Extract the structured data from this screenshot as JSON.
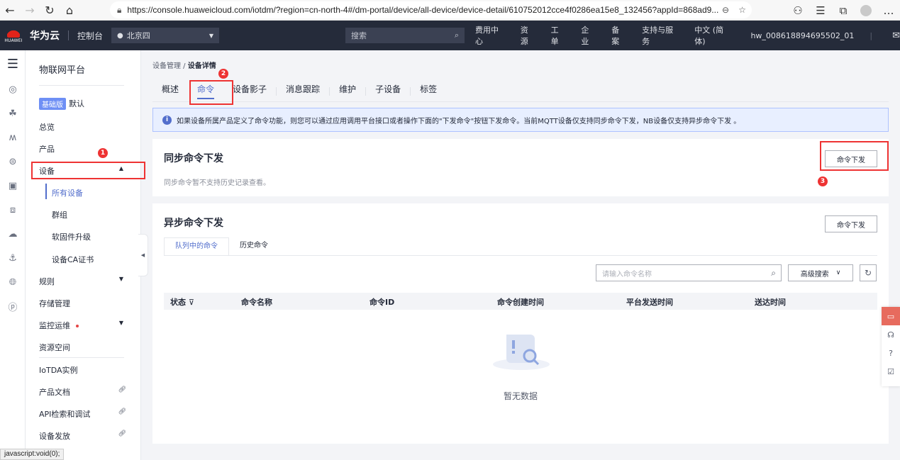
{
  "browser": {
    "url": "https://console.huaweicloud.com/iotdm/?region=cn-north-4#/dm-portal/device/all-device/device-detail/610752012cce4f0286ea15e8_132456?appId=868ad9...",
    "status_url": "javascript:void(0);"
  },
  "topnav": {
    "brand": "华为云",
    "logo_text": "HUAWEI",
    "console": "控制台",
    "region": "北京四",
    "search_placeholder": "搜索",
    "menu": [
      "费用中心",
      "资源",
      "工单",
      "企业",
      "备案",
      "支持与服务",
      "中文 (简体)"
    ],
    "user": "hw_008618894695502_01"
  },
  "sidebar": {
    "title": "物联网平台",
    "edition_badge": "基础版",
    "edition_name": "默认",
    "overview": "总览",
    "product": "产品",
    "device": "设备",
    "device_sub": [
      "所有设备",
      "群组",
      "软固件升级",
      "设备CA证书"
    ],
    "rules": "规则",
    "storage": "存储管理",
    "monitor": "监控运维",
    "resource_space": "资源空间",
    "iotda_instance": "IoTDA实例",
    "product_docs": "产品文档",
    "api_explorer": "API检索和调试",
    "device_provision": "设备发放"
  },
  "annotations": [
    "1",
    "2",
    "3"
  ],
  "main": {
    "breadcrumb_parent": "设备管理",
    "breadcrumb_sep": " / ",
    "breadcrumb_current": "设备详情",
    "tabs": [
      "概述",
      "命令",
      "设备影子",
      "消息跟踪",
      "维护",
      "子设备",
      "标签"
    ],
    "active_tab": "命令",
    "notice": "如果设备所属产品定义了命令功能，则您可以通过应用调用平台接口或者操作下面的\"下发命令\"按钮下发命令。当前MQTT设备仅支持同步命令下发，NB设备仅支持异步命令下发 。",
    "sync": {
      "title": "同步命令下发",
      "desc": "同步命令暂不支持历史记录查看。",
      "button": "命令下发"
    },
    "async": {
      "title": "异步命令下发",
      "button": "命令下发",
      "subtabs": [
        "队列中的命令",
        "历史命令"
      ],
      "search_placeholder": "请输入命令名称",
      "advanced_search": "高级搜索",
      "columns": [
        "状态",
        "命令名称",
        "命令ID",
        "命令创建时间",
        "平台发送时间",
        "送达时间"
      ],
      "empty_text": "暂无数据"
    }
  },
  "colors": {
    "accent": "#526ecc",
    "annotation": "#ee3333",
    "topbar": "#252b3a"
  }
}
